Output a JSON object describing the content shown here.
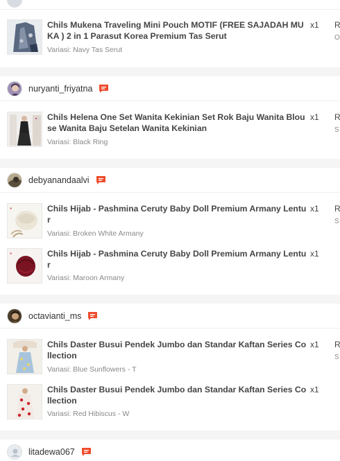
{
  "orders": [
    {
      "username": "",
      "items": [
        {
          "name": "Chils Mukena Traveling Mini Pouch MOTIF (FREE SAJADAH MUKA ) 2 in 1 Parasut Korea Premium Tas Serut",
          "variation": "Variasi: Navy Tas Serut",
          "qty": "x1",
          "col_a": "R",
          "col_b": "O"
        }
      ]
    },
    {
      "username": "nuryanti_friyatna",
      "items": [
        {
          "name": "Chils Helena One Set Wanita Kekinian Set Rok Baju Wanita Blouse Wanita Baju Setelan Wanita Kekinian",
          "variation": "Variasi: Black Ring",
          "qty": "x1",
          "col_a": "R",
          "col_b": "S"
        }
      ]
    },
    {
      "username": "debyanandaalvi",
      "items": [
        {
          "name": "Chils Hijab - Pashmina Ceruty Baby Doll Premium Armany Lentur",
          "variation": "Variasi: Broken White Armany",
          "qty": "x1",
          "col_a": "R",
          "col_b": "S"
        },
        {
          "name": "Chils Hijab - Pashmina Ceruty Baby Doll Premium Armany Lentur",
          "variation": "Variasi: Maroon Armany",
          "qty": "x1"
        }
      ]
    },
    {
      "username": "octavianti_ms",
      "items": [
        {
          "name": "Chils Daster Busui Pendek Jumbo dan Standar Kaftan Series Collection",
          "variation": "Variasi: Blue Sunflowers - T",
          "qty": "x1",
          "col_a": "R",
          "col_b": "S"
        },
        {
          "name": "Chils Daster Busui Pendek Jumbo dan Standar Kaftan Series Collection",
          "variation": "Variasi: Red Hibiscus - W",
          "qty": "x1"
        }
      ]
    },
    {
      "username": "litadewa067"
    }
  ],
  "colors": {
    "chat_icon": "#ee4d2d",
    "background": "#f5f5f5",
    "card": "#ffffff"
  },
  "icons": {
    "chat": "chat-bubble-icon",
    "default_avatar": "user-avatar-icon"
  }
}
